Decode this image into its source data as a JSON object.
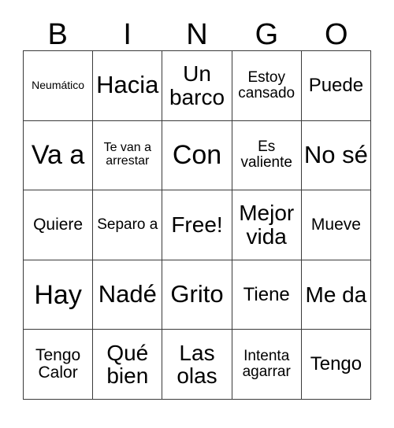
{
  "card": {
    "headers": [
      "B",
      "I",
      "N",
      "G",
      "O"
    ],
    "rows": [
      [
        {
          "text": "Neumático",
          "size": "xs"
        },
        {
          "text": "Hacia",
          "size": "xxl"
        },
        {
          "text": "Un barco",
          "size": "xl"
        },
        {
          "text": "Estoy cansado",
          "size": "m"
        },
        {
          "text": "Puede",
          "size": "l"
        }
      ],
      [
        {
          "text": "Va a",
          "size": "3xl"
        },
        {
          "text": "Te van a arrestar",
          "size": "s"
        },
        {
          "text": "Con",
          "size": "3xl"
        },
        {
          "text": "Es valiente",
          "size": "m"
        },
        {
          "text": "No sé",
          "size": "xxl"
        }
      ],
      [
        {
          "text": "Quiere",
          "size": "ml"
        },
        {
          "text": "Separo a",
          "size": "m"
        },
        {
          "text": "Free!",
          "size": "xl"
        },
        {
          "text": "Mejor vida",
          "size": "xl"
        },
        {
          "text": "Mueve",
          "size": "ml"
        }
      ],
      [
        {
          "text": "Hay",
          "size": "3xl"
        },
        {
          "text": "Nadé",
          "size": "xxl"
        },
        {
          "text": "Grito",
          "size": "xxl"
        },
        {
          "text": "Tiene",
          "size": "l"
        },
        {
          "text": "Me da",
          "size": "xl"
        }
      ],
      [
        {
          "text": "Tengo Calor",
          "size": "ml"
        },
        {
          "text": "Qué bien",
          "size": "xl"
        },
        {
          "text": "Las olas",
          "size": "xl"
        },
        {
          "text": "Intenta agarrar",
          "size": "m"
        },
        {
          "text": "Tengo",
          "size": "l"
        }
      ]
    ],
    "free_space_label": "Free!",
    "colors": {
      "background": "#ffffff",
      "text": "#000000",
      "border": "#3a3a3a"
    }
  }
}
